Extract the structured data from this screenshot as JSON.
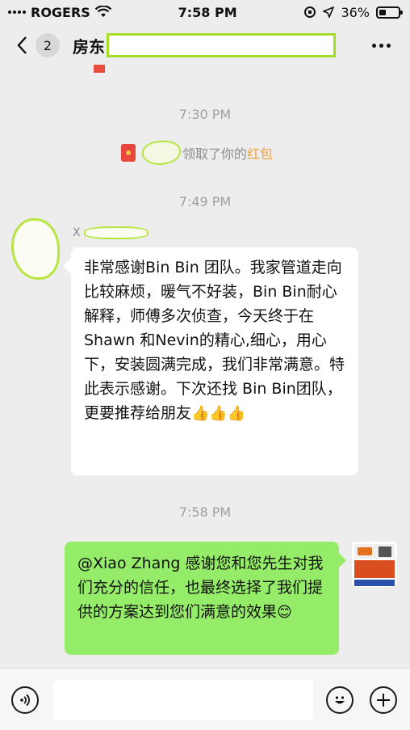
{
  "status_bar": {
    "carrier": "ROGERS",
    "time": "7:58 PM",
    "battery_text": "36%",
    "battery_level": 0.36
  },
  "header": {
    "unread_count": "2",
    "title_visible": "房东"
  },
  "messages": {
    "time_1": "7:30 PM",
    "system_prefix": "领取了你的",
    "system_highlight": "红包",
    "time_2": "7:49 PM",
    "sender_initial": "X",
    "incoming_text": "非常感谢Bin Bin 团队。我家管道走向比较麻烦，暖气不好装，Bin Bin耐心解释，师傅多次侦查，今天终于在Shawn 和Nevin的精心,细心，用心下，安装圆满完成，我们非常满意。特此表示感谢。下次还找 Bin Bin团队，更要推荐给朋友",
    "incoming_emoji": "👍👍👍",
    "time_3": "7:58 PM",
    "outgoing_text": "@Xiao Zhang 感谢您和您先生对我们充分的信任，也最终选择了我们提供的方案达到您们满意的效果",
    "outgoing_emoji": "😊"
  },
  "colors": {
    "background": "#ededed",
    "outgoing_bubble": "#95ec69",
    "incoming_bubble": "#ffffff",
    "red_packet": "#e8453c",
    "highlight": "#f0a33a",
    "redaction_outline": "#a4dc2a"
  },
  "icons": {
    "back": "chevron-left-icon",
    "more": "more-dots-icon",
    "voice": "voice-icon",
    "emoji": "smiley-icon",
    "add": "plus-icon",
    "red_packet": "red-packet-icon"
  }
}
